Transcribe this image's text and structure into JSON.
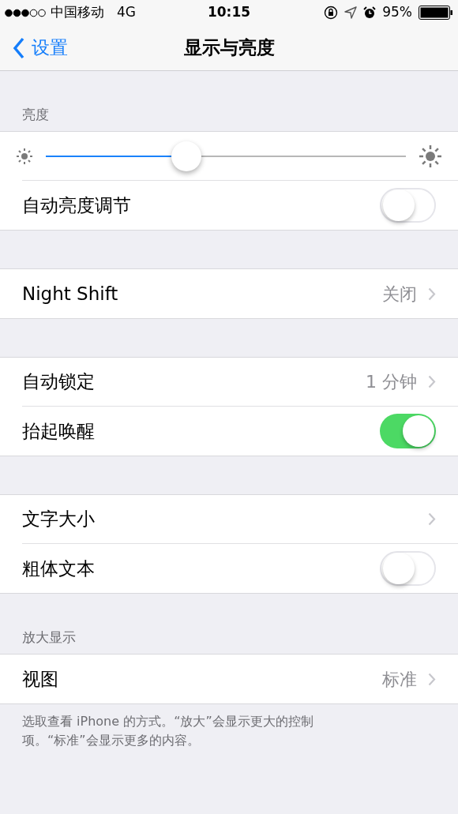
{
  "status_bar": {
    "carrier": "中国移动",
    "network": "4G",
    "time": "10:15",
    "battery": "95%"
  },
  "nav": {
    "back": "设置",
    "title": "显示与亮度"
  },
  "sections": [
    {
      "header": "亮度",
      "rows": [
        {
          "kind": "slider",
          "level": 0.39
        },
        {
          "kind": "toggle",
          "label": "自动亮度调节",
          "on": false
        }
      ]
    },
    {
      "rows": [
        {
          "kind": "link",
          "label": "Night Shift",
          "value": "关闭"
        }
      ]
    },
    {
      "rows": [
        {
          "kind": "link",
          "label": "自动锁定",
          "value": "1 分钟"
        },
        {
          "kind": "toggle",
          "label": "抬起唤醒",
          "on": true
        }
      ]
    },
    {
      "rows": [
        {
          "kind": "link",
          "label": "文字大小"
        },
        {
          "kind": "toggle",
          "label": "粗体文本",
          "on": false
        }
      ]
    },
    {
      "header": "放大显示",
      "rows": [
        {
          "kind": "link",
          "label": "视图",
          "value": "标准"
        }
      ],
      "footer": "选取查看 iPhone 的方式。“放大”会显示更大的控制项。“标准”会显示更多的内容。"
    }
  ]
}
